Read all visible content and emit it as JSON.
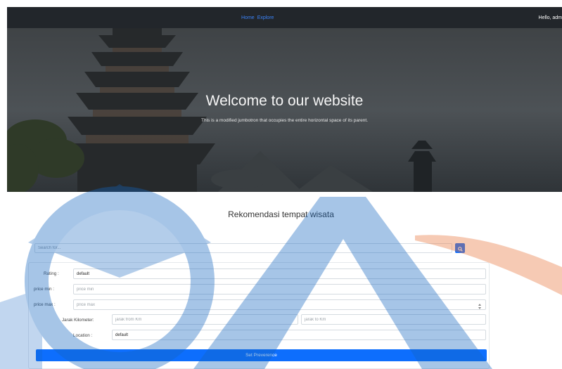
{
  "navbar": {
    "links": [
      "Home",
      "Explore"
    ],
    "greeting": "Hello, adm"
  },
  "hero": {
    "title": "Welcome to our website",
    "subtitle": "This is a modified jumbotron that occupies the entire horizontal space of its parent."
  },
  "section": {
    "title": "Rekomendasi tempat wisata"
  },
  "search": {
    "placeholder": "Search for...",
    "button_icon": "search-icon"
  },
  "form": {
    "rating": {
      "label": "Rating :",
      "value": "default"
    },
    "price_min": {
      "label": "price min :",
      "placeholder": "price min"
    },
    "price_max": {
      "label": "price max :",
      "placeholder": "price max"
    },
    "jarak": {
      "label": "Jarak Kilometer:",
      "from_placeholder": "jarak from Km",
      "to_placeholder": "jarak to Km"
    },
    "location": {
      "label": "Location :",
      "value": "default"
    },
    "submit_label": "Set Preverence"
  },
  "colors": {
    "navbar_bg": "#22262b",
    "accent": "#0d6efd",
    "watermark_blue": "#1565c0",
    "watermark_orange": "#e8733a"
  }
}
